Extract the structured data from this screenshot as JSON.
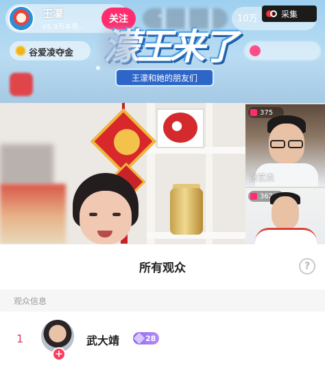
{
  "anchor": {
    "name": "王濛",
    "fans": "65.9万本场..."
  },
  "header": {
    "follow_label": "关注",
    "viewer_count": "10万",
    "collect_label": "采集"
  },
  "task": {
    "label": "谷爱凌夺金"
  },
  "show": {
    "title": "濛王来了",
    "subtitle": "王濛和她的朋友们"
  },
  "cohosts": [
    {
      "count": "375",
      "name": "张艺杰"
    },
    {
      "count": "362",
      "name": ""
    }
  ],
  "panel": {
    "title": "所有观众",
    "help_icon": "question-icon",
    "section_label": "观众信息"
  },
  "audience": [
    {
      "rank": "1",
      "name": "武大靖",
      "level": "28"
    }
  ],
  "colors": {
    "accent": "#ff2d6f",
    "rank": "#e6395e",
    "level_badge": "#9b74f2"
  }
}
